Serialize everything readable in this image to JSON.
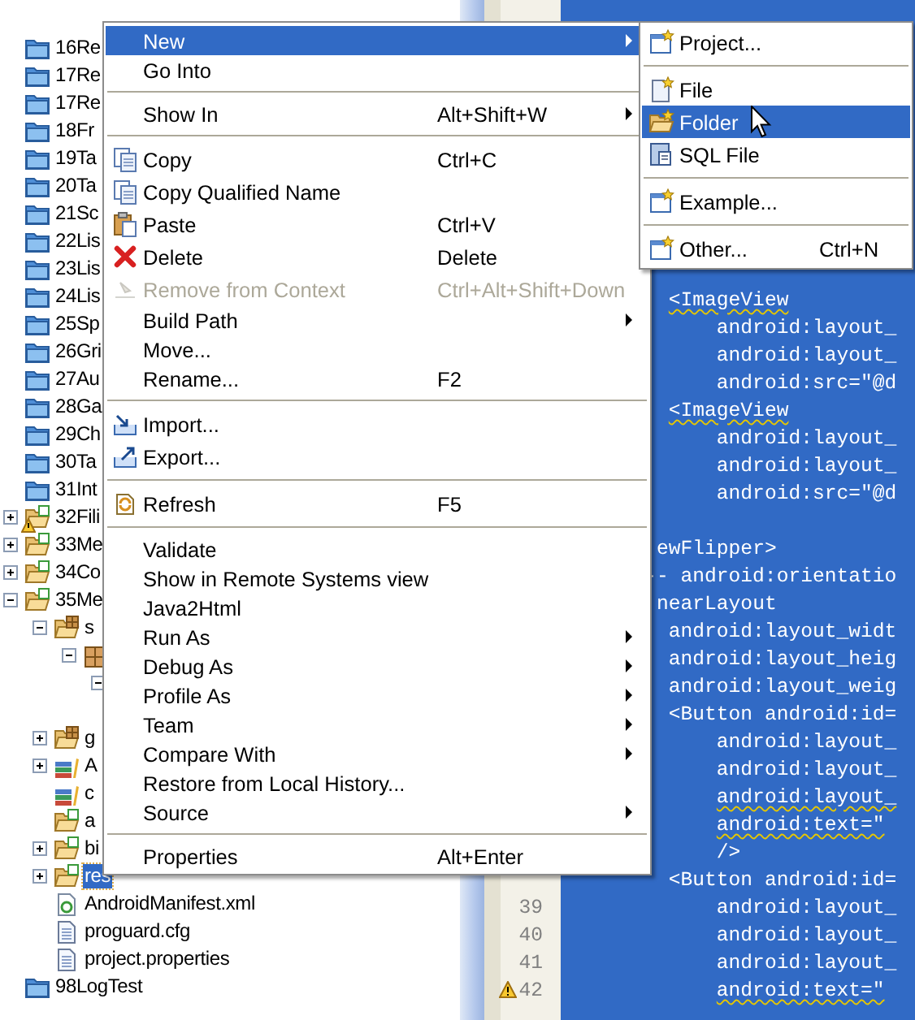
{
  "tree": [
    {
      "label": "16Re",
      "kind": "closed-project",
      "selected": false,
      "warning": false
    },
    {
      "label": "17Re",
      "kind": "closed-project",
      "selected": false,
      "warning": false
    },
    {
      "label": "17Re",
      "kind": "closed-project",
      "selected": false,
      "warning": false
    },
    {
      "label": "18Fr",
      "kind": "closed-project",
      "selected": false,
      "warning": false
    },
    {
      "label": "19Ta",
      "kind": "closed-project",
      "selected": false,
      "warning": false
    },
    {
      "label": "20Ta",
      "kind": "closed-project",
      "selected": false,
      "warning": false
    },
    {
      "label": "21Sc",
      "kind": "closed-project",
      "selected": false,
      "warning": false
    },
    {
      "label": "22Lis",
      "kind": "closed-project",
      "selected": false,
      "warning": false
    },
    {
      "label": "23Lis",
      "kind": "closed-project",
      "selected": false,
      "warning": false
    },
    {
      "label": "24Lis",
      "kind": "closed-project",
      "selected": false,
      "warning": false
    },
    {
      "label": "25Sp",
      "kind": "closed-project",
      "selected": false,
      "warning": false
    },
    {
      "label": "26Gri",
      "kind": "closed-project",
      "selected": false,
      "warning": false
    },
    {
      "label": "27Au",
      "kind": "closed-project",
      "selected": false,
      "warning": false
    },
    {
      "label": "28Ga",
      "kind": "closed-project",
      "selected": false,
      "warning": false
    },
    {
      "label": "29Ch",
      "kind": "closed-project",
      "selected": false,
      "warning": false
    },
    {
      "label": "30Ta",
      "kind": "closed-project",
      "selected": false,
      "warning": false
    },
    {
      "label": "31Int",
      "kind": "closed-project",
      "selected": false,
      "warning": false
    },
    {
      "label": "32Fili",
      "kind": "project",
      "expanded": false,
      "selected": false,
      "warning": true
    },
    {
      "label": "33Me",
      "kind": "project",
      "expanded": false,
      "selected": false,
      "warning": false
    },
    {
      "label": "34Co",
      "kind": "project",
      "expanded": false,
      "selected": false,
      "warning": false
    },
    {
      "label": "35Me",
      "kind": "project",
      "expanded": true,
      "selected": false,
      "warning": false,
      "children": [
        {
          "label": "s",
          "kind": "source-folder",
          "expanded": true,
          "selected": false,
          "children": [
            {
              "kind": "package",
              "expanded": true,
              "children": [
                {
                  "expanded": true
                }
              ]
            }
          ]
        },
        {
          "label": "g",
          "kind": "source-folder",
          "expanded": false,
          "selected": false
        },
        {
          "label": "A",
          "kind": "library",
          "expanded": false,
          "selected": false
        },
        {
          "label": "c",
          "kind": "library",
          "selected": false
        },
        {
          "label": "a",
          "kind": "folder",
          "selected": false
        },
        {
          "label": "bi",
          "kind": "folder",
          "expanded": false,
          "selected": false
        },
        {
          "label": "res",
          "kind": "folder",
          "expanded": false,
          "selected": true
        },
        {
          "label": "AndroidManifest.xml",
          "kind": "xml-file",
          "selected": false
        },
        {
          "label": "proguard.cfg",
          "kind": "text-file",
          "selected": false
        },
        {
          "label": "project.properties",
          "kind": "text-file",
          "selected": false
        }
      ]
    },
    {
      "label": "98LogTest",
      "kind": "closed-project",
      "selected": false,
      "warning": false
    }
  ],
  "editor": {
    "blocks": [
      {
        "lines": [
          {
            "text": "         <ImageView",
            "squiggle": true,
            "warning": false
          },
          {
            "text": "             android:layout_",
            "squiggle": false,
            "warning": false
          },
          {
            "text": "             android:layout_",
            "squiggle": false,
            "warning": false
          },
          {
            "text": "             android:src=\"@d",
            "squiggle": false,
            "warning": false
          },
          {
            "text": "         <ImageView",
            "squiggle": true,
            "warning": false
          },
          {
            "text": "             android:layout_",
            "squiggle": false,
            "warning": false
          },
          {
            "text": "             android:layout_",
            "squiggle": false,
            "warning": false
          },
          {
            "text": "             android:src=\"@d",
            "squiggle": false,
            "warning": false
          }
        ]
      },
      {
        "lines": [
          {
            "text": "        ewFlipper>",
            "squiggle": false,
            "warning": false
          },
          {
            "text": "       -- android:orientatio",
            "squiggle": false,
            "warning": false
          },
          {
            "text": "        nearLayout",
            "squiggle": false,
            "warning": false
          },
          {
            "text": "         android:layout_widt",
            "squiggle": false,
            "warning": false
          },
          {
            "text": "         android:layout_heig",
            "squiggle": false,
            "warning": false
          },
          {
            "text": "         android:layout_weig",
            "squiggle": false,
            "warning": false
          },
          {
            "text": "         <Button android:id=",
            "squiggle": false,
            "warning": false
          },
          {
            "text": "             android:layout_",
            "squiggle": false,
            "warning": false
          },
          {
            "text": "             android:layout_",
            "squiggle": false,
            "warning": false
          },
          {
            "text": "             android:layout_",
            "squiggle": true,
            "warning": false
          },
          {
            "text": "             android:text=\"",
            "squiggle": true,
            "warning": false
          },
          {
            "text": "             />",
            "squiggle": false,
            "warning": false
          },
          {
            "text": "         <Button android:id=",
            "squiggle": false,
            "warning": false
          },
          {
            "number": "39",
            "text": "             android:layout_",
            "squiggle": false,
            "warning": false
          },
          {
            "number": "40",
            "text": "             android:layout_",
            "squiggle": false,
            "warning": false
          },
          {
            "number": "41",
            "text": "             android:layout_",
            "squiggle": false,
            "warning": false
          },
          {
            "number": "42",
            "text": "             android:text=\"",
            "squiggle": true,
            "warning": true
          }
        ]
      }
    ]
  },
  "context_menu": {
    "items": [
      {
        "kind": "item",
        "label": "New",
        "selected": true,
        "disabled": false,
        "submenu": true
      },
      {
        "kind": "item",
        "label": "Go Into",
        "selected": false,
        "disabled": false,
        "submenu": false
      },
      {
        "kind": "separator"
      },
      {
        "kind": "item",
        "label": "Show In",
        "shortcut": "Alt+Shift+W",
        "selected": false,
        "disabled": false,
        "submenu": true
      },
      {
        "kind": "separator"
      },
      {
        "kind": "item",
        "label": "Copy",
        "shortcut": "Ctrl+C",
        "selected": false,
        "disabled": false,
        "submenu": false
      },
      {
        "kind": "item",
        "label": "Copy Qualified Name",
        "selected": false,
        "disabled": false,
        "submenu": false
      },
      {
        "kind": "item",
        "label": "Paste",
        "shortcut": "Ctrl+V",
        "selected": false,
        "disabled": false,
        "submenu": false
      },
      {
        "kind": "item",
        "label": "Delete",
        "shortcut": "Delete",
        "selected": false,
        "disabled": false,
        "submenu": false
      },
      {
        "kind": "item",
        "label": "Remove from Context",
        "shortcut": "Ctrl+Alt+Shift+Down",
        "selected": false,
        "disabled": true,
        "submenu": false
      },
      {
        "kind": "item",
        "label": "Build Path",
        "selected": false,
        "disabled": false,
        "submenu": true
      },
      {
        "kind": "item",
        "label": "Move...",
        "selected": false,
        "disabled": false,
        "submenu": false
      },
      {
        "kind": "item",
        "label": "Rename...",
        "shortcut": "F2",
        "selected": false,
        "disabled": false,
        "submenu": false
      },
      {
        "kind": "separator"
      },
      {
        "kind": "item",
        "label": "Import...",
        "selected": false,
        "disabled": false,
        "submenu": false
      },
      {
        "kind": "item",
        "label": "Export...",
        "selected": false,
        "disabled": false,
        "submenu": false
      },
      {
        "kind": "separator"
      },
      {
        "kind": "item",
        "label": "Refresh",
        "shortcut": "F5",
        "selected": false,
        "disabled": false,
        "submenu": false
      },
      {
        "kind": "separator"
      },
      {
        "kind": "item",
        "label": "Validate",
        "selected": false,
        "disabled": false,
        "submenu": false
      },
      {
        "kind": "item",
        "label": "Show in Remote Systems view",
        "selected": false,
        "disabled": false,
        "submenu": false
      },
      {
        "kind": "item",
        "label": "Java2Html",
        "selected": false,
        "disabled": false,
        "submenu": false
      },
      {
        "kind": "item",
        "label": "Run As",
        "selected": false,
        "disabled": false,
        "submenu": true
      },
      {
        "kind": "item",
        "label": "Debug As",
        "selected": false,
        "disabled": false,
        "submenu": true
      },
      {
        "kind": "item",
        "label": "Profile As",
        "selected": false,
        "disabled": false,
        "submenu": true
      },
      {
        "kind": "item",
        "label": "Team",
        "selected": false,
        "disabled": false,
        "submenu": true
      },
      {
        "kind": "item",
        "label": "Compare With",
        "selected": false,
        "disabled": false,
        "submenu": true
      },
      {
        "kind": "item",
        "label": "Restore from Local History...",
        "selected": false,
        "disabled": false,
        "submenu": false
      },
      {
        "kind": "item",
        "label": "Source",
        "selected": false,
        "disabled": false,
        "submenu": true
      },
      {
        "kind": "separator"
      },
      {
        "kind": "item",
        "label": "Properties",
        "shortcut": "Alt+Enter",
        "selected": false,
        "disabled": false,
        "submenu": false
      }
    ]
  },
  "new_submenu": {
    "items": [
      {
        "kind": "item",
        "label": "Project...",
        "selected": false,
        "disabled": false,
        "submenu": false
      },
      {
        "kind": "separator"
      },
      {
        "kind": "item",
        "label": "File",
        "selected": false,
        "disabled": false,
        "submenu": false
      },
      {
        "kind": "item",
        "label": "Folder",
        "selected": true,
        "disabled": false,
        "submenu": false
      },
      {
        "kind": "item",
        "label": "SQL File",
        "selected": false,
        "disabled": false,
        "submenu": false
      },
      {
        "kind": "separator"
      },
      {
        "kind": "item",
        "label": "Example...",
        "selected": false,
        "disabled": false,
        "submenu": false
      },
      {
        "kind": "separator"
      },
      {
        "kind": "item",
        "label": "Other...",
        "shortcut": "Ctrl+N",
        "selected": false,
        "disabled": false,
        "submenu": false
      }
    ]
  }
}
